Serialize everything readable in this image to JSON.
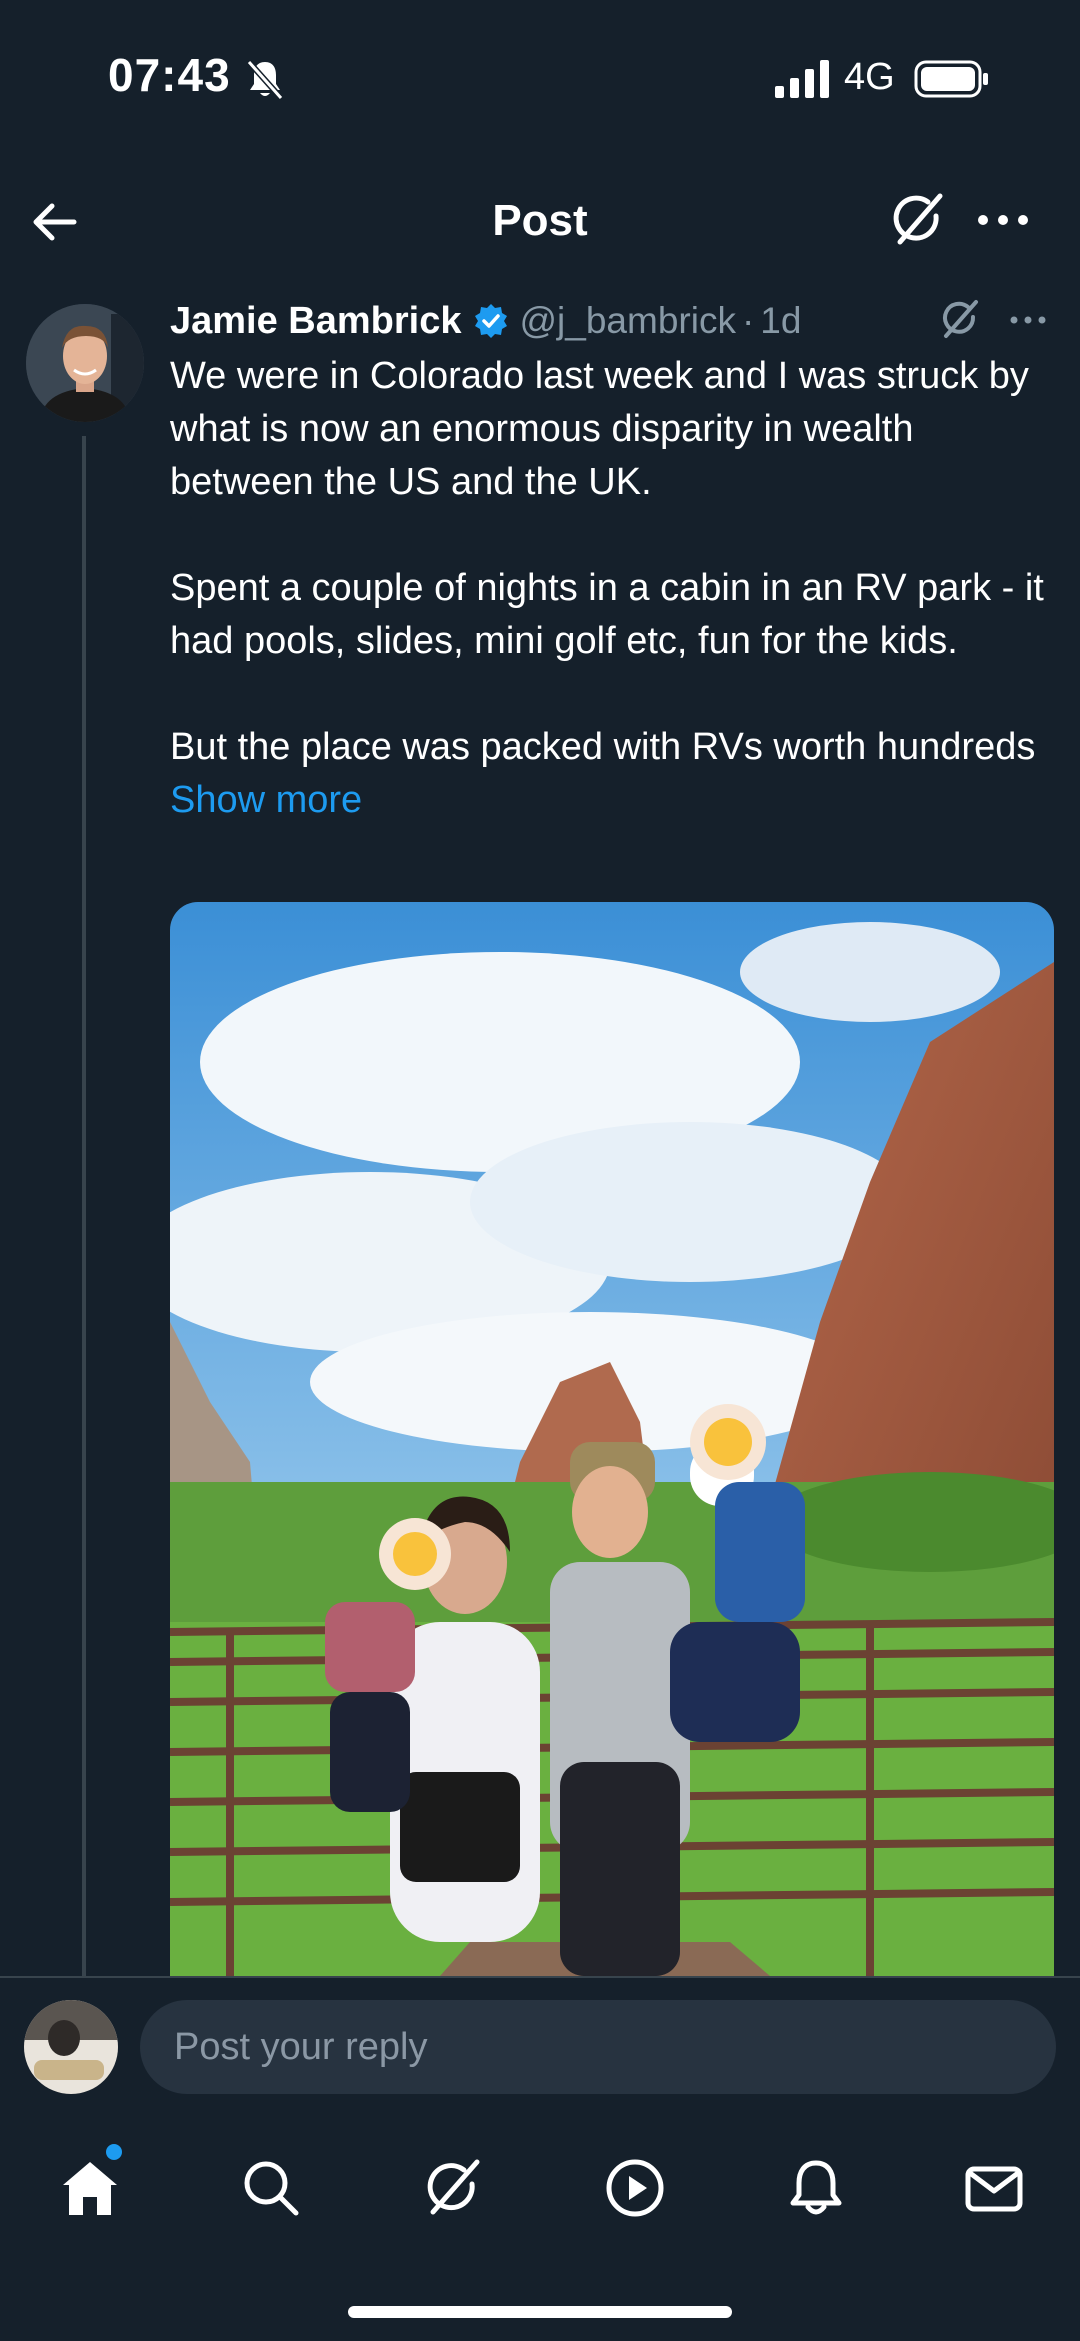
{
  "status_bar": {
    "time": "07:43",
    "network": "4G",
    "icons": [
      "bell-off-icon",
      "signal-icon",
      "battery-icon"
    ]
  },
  "header": {
    "title": "Post",
    "icons": [
      "back-arrow-icon",
      "grok-icon",
      "more-icon"
    ]
  },
  "post": {
    "author_name": "Jamie Bambrick",
    "handle": "@j_bambrick",
    "separator": "·",
    "time_ago": "1d",
    "paragraphs": [
      "We were in Colorado last week and I was struck by what is now an enormous disparity in wealth between the US and the UK.",
      "Spent a couple of nights in a cabin in an RV park - it had pools, slides, mini golf etc, fun for the kids."
    ],
    "last_paragraph": "But the place was packed with RVs worth hundreds",
    "show_more": "Show more",
    "media_icon": "family-photo-image"
  },
  "reply": {
    "placeholder": "Post your reply"
  },
  "nav": {
    "items": [
      "home-icon",
      "search-icon",
      "grok-icon",
      "video-icon",
      "notifications-icon",
      "messages-icon"
    ],
    "active": "home-icon"
  },
  "colors": {
    "background": "#15202b",
    "accent": "#1d9bf0",
    "secondary_text": "#8899a6",
    "divider": "#38444d"
  }
}
